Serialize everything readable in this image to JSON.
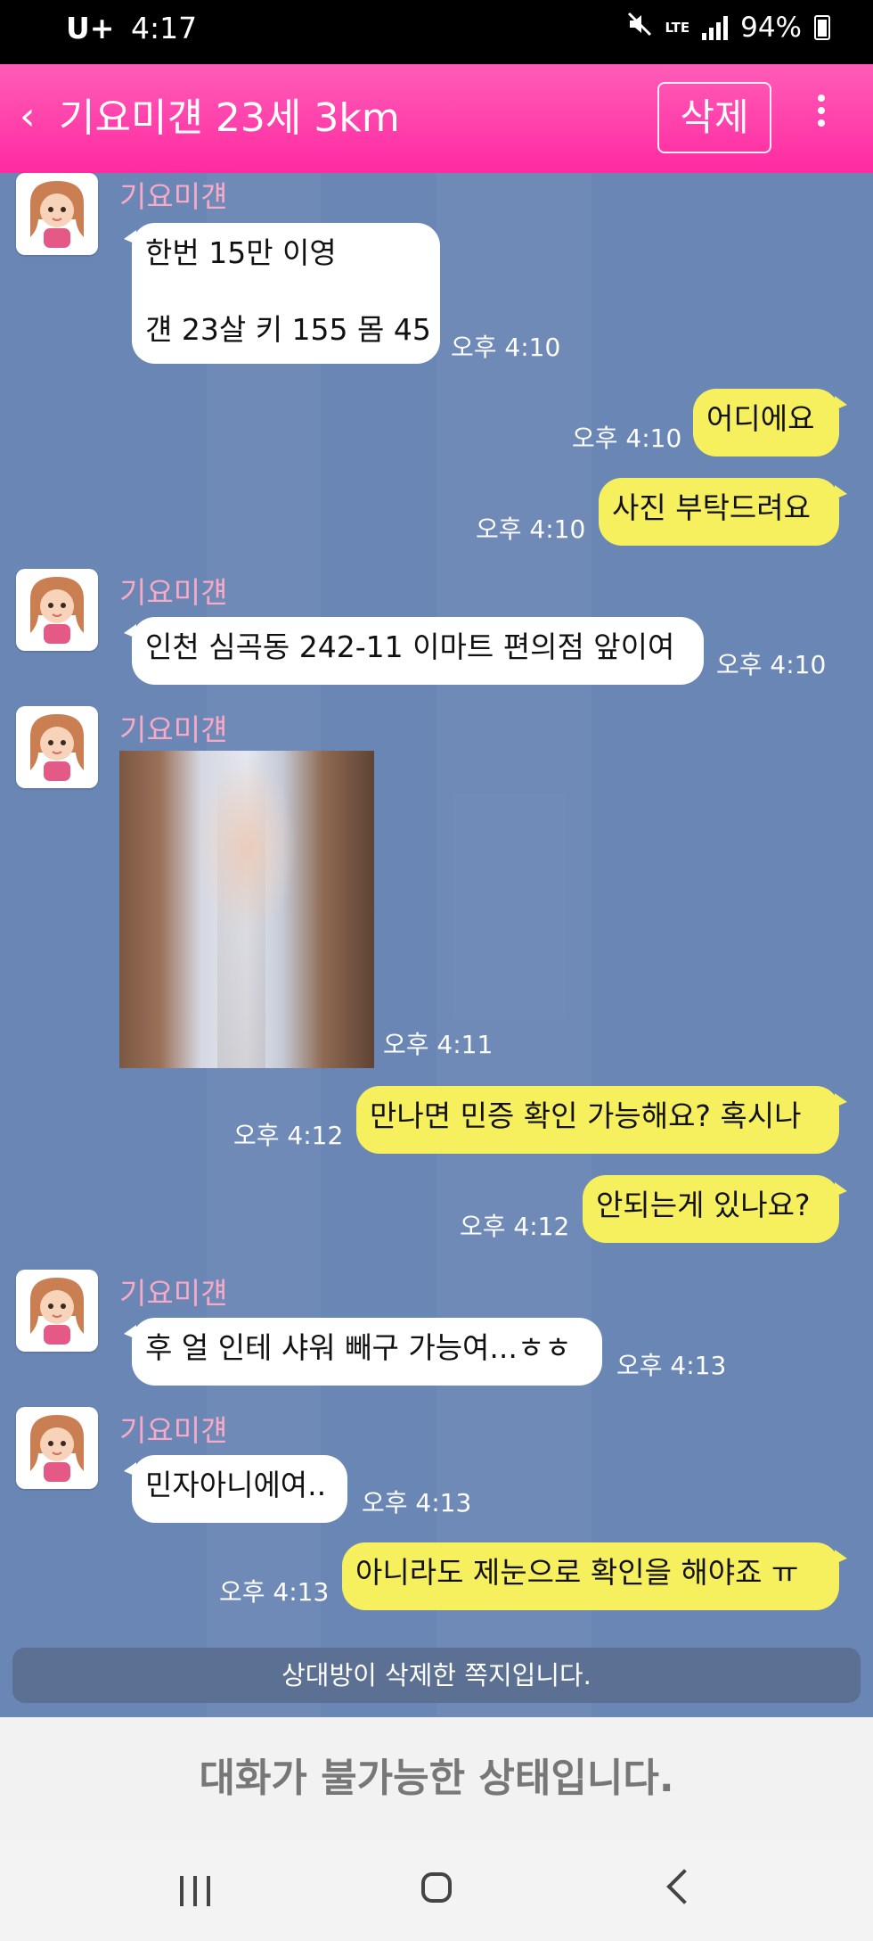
{
  "status_bar": {
    "carrier": "U+",
    "time": "4:17",
    "network": "LTE",
    "battery": "94%",
    "icons": [
      "mute-icon",
      "signal-icon",
      "battery-icon"
    ]
  },
  "header": {
    "back_icon": "chevron-left-icon",
    "title": "기요미걘 23세 3km",
    "delete_label": "삭제",
    "more_icon": "kebab-menu-icon",
    "background_color": "#ff2aa1"
  },
  "chat": {
    "sender_name": "기요미걘",
    "messages": [
      {
        "side": "in",
        "text_lines": [
          "한번 15만 이영",
          "",
          "걘 23살 키 155 몸 45"
        ],
        "time": "오후 4:10"
      },
      {
        "side": "out",
        "text": "어디에요",
        "time": "오후 4:10"
      },
      {
        "side": "out",
        "text": "사진 부탁드려요",
        "time": "오후 4:10"
      },
      {
        "side": "in",
        "text": "인천 심곡동 242-11 이마트 편의점 앞이여",
        "time": "오후 4:10"
      },
      {
        "side": "in",
        "type": "image",
        "time": "오후 4:11"
      },
      {
        "side": "out",
        "text": "만나면 민증 확인 가능해요? 혹시나",
        "time": "오후 4:12"
      },
      {
        "side": "out",
        "text": "안되는게 있나요?",
        "time": "오후 4:12"
      },
      {
        "side": "in",
        "text": "후 얼 인테 샤워 빼구 가능여...ㅎㅎ",
        "time": "오후 4:13"
      },
      {
        "side": "in",
        "text": "민자아니에여..",
        "time": "오후 4:13"
      },
      {
        "side": "out",
        "text": "아니라도 제눈으로 확인을 해야죠 ㅠ",
        "time": "오후 4:13"
      }
    ],
    "deleted_notice": "상대방이 삭제한 쪽지입니다."
  },
  "footer": {
    "status_text": "대화가 불가능한 상태입니다."
  },
  "nav": {
    "icons": [
      "recent-apps-icon",
      "home-icon",
      "back-icon"
    ]
  },
  "colors": {
    "chat_background": "#6a86b4",
    "incoming_bubble": "#ffffff",
    "outgoing_bubble": "#f6ef5e",
    "sender_name": "#f7a9c6"
  }
}
